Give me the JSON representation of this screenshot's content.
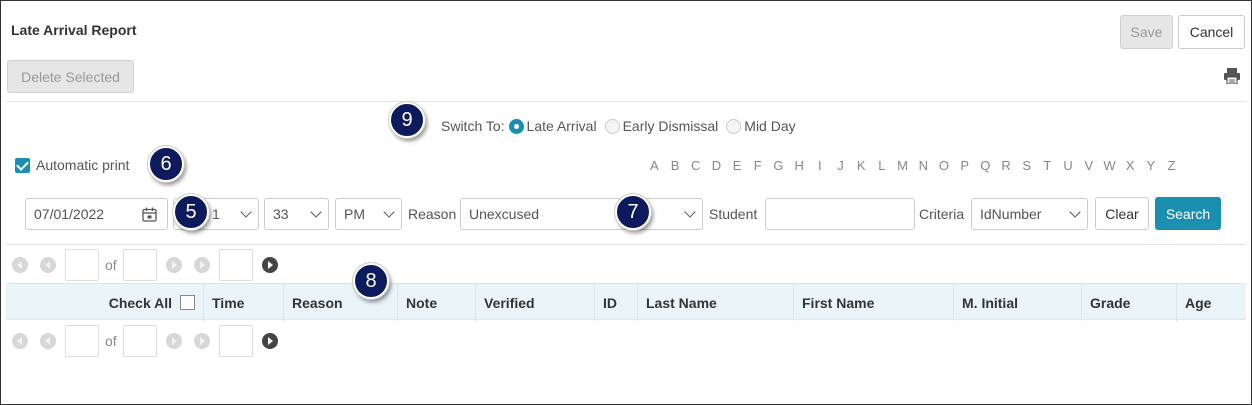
{
  "header": {
    "title": "Late Arrival Report",
    "save_label": "Save",
    "cancel_label": "Cancel"
  },
  "toolbar": {
    "delete_label": "Delete Selected"
  },
  "switch": {
    "label": "Switch To:",
    "options": [
      {
        "label": "Late Arrival",
        "selected": true
      },
      {
        "label": "Early Dismissal",
        "selected": false
      },
      {
        "label": "Mid Day",
        "selected": false
      }
    ]
  },
  "auto_print": {
    "label": "Automatic print",
    "checked": true
  },
  "alphabet": [
    "A",
    "B",
    "C",
    "D",
    "E",
    "F",
    "G",
    "H",
    "I",
    "J",
    "K",
    "L",
    "M",
    "N",
    "O",
    "P",
    "Q",
    "R",
    "S",
    "T",
    "U",
    "V",
    "W",
    "X",
    "Y",
    "Z"
  ],
  "filters": {
    "date": "07/01/2022",
    "hour": "1",
    "minute": "33",
    "ampm": "PM",
    "reason_label": "Reason",
    "reason_value": "Unexcused",
    "student_label": "Student",
    "student_value": "",
    "criteria_label": "Criteria",
    "criteria_value": "IdNumber",
    "clear_label": "Clear",
    "search_label": "Search"
  },
  "pager": {
    "of_label": "of"
  },
  "table": {
    "check_all_label": "Check All",
    "columns": [
      "Time",
      "Reason",
      "Note",
      "Verified",
      "ID",
      "Last Name",
      "First Name",
      "M. Initial",
      "Grade",
      "Age"
    ]
  },
  "callouts": [
    "9",
    "6",
    "5",
    "7",
    "8"
  ],
  "colors": {
    "accent": "#1a8fb0",
    "callout": "#0d1b5e",
    "header_bg": "#e8f4f8"
  }
}
